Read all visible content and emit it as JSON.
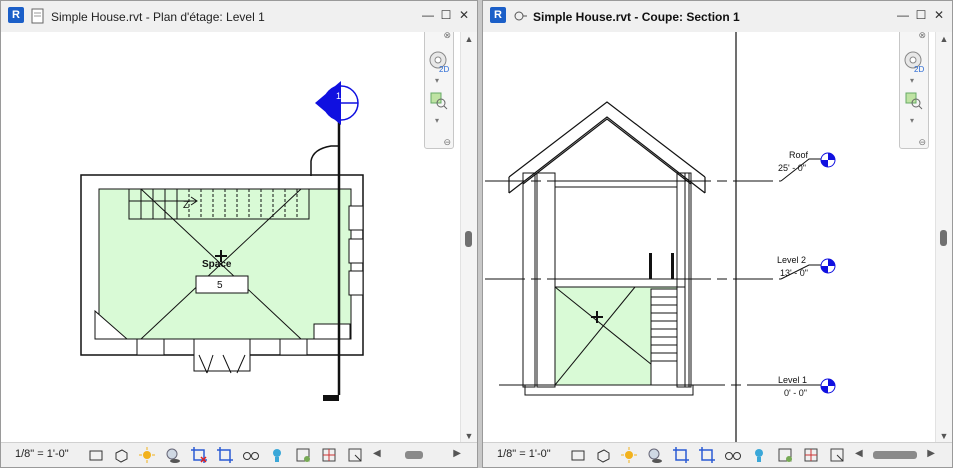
{
  "app": {
    "badge": "R"
  },
  "left_window": {
    "title": "Simple House.rvt - Plan d'étage: Level 1",
    "scale": "1/8\" = 1'-0\"",
    "space_label": "Space",
    "space_number": "5",
    "section_head": "1",
    "stair_mark": "Z"
  },
  "right_window": {
    "title": "Simple House.rvt - Coupe: Section 1",
    "scale": "1/8\" = 1'-0\"",
    "levels": [
      {
        "name": "Roof",
        "elevation": "25' - 0\""
      },
      {
        "name": "Level 2",
        "elevation": "13' - 0\""
      },
      {
        "name": "Level 1",
        "elevation": "0' - 0\""
      }
    ]
  },
  "window_buttons": {
    "minimize": "—",
    "maximize": "☐",
    "close": "✕"
  },
  "navbar": {
    "label_2d": "2D",
    "close": "⊗",
    "options": "⊖"
  },
  "colors": {
    "space_fill": "#d9fad6",
    "accent_blue": "#1b5fc8",
    "section_blue": "#1010e0"
  }
}
